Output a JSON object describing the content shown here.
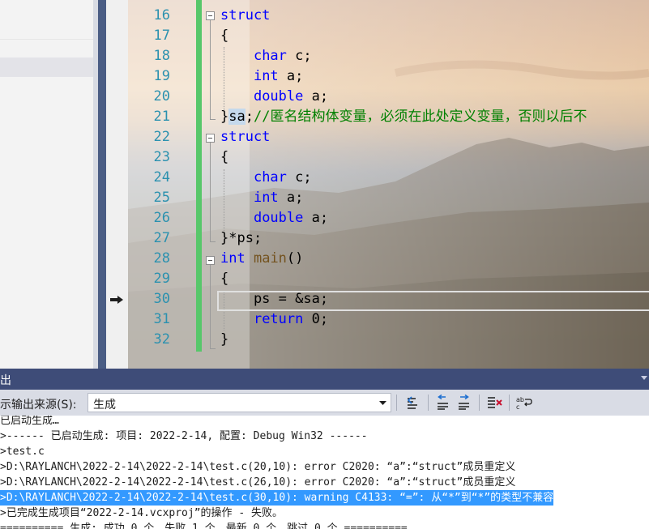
{
  "editor": {
    "line_numbers": [
      "16",
      "17",
      "18",
      "19",
      "20",
      "21",
      "22",
      "23",
      "24",
      "25",
      "26",
      "27",
      "28",
      "29",
      "30",
      "31",
      "32"
    ],
    "lines": [
      [
        {
          "t": "struct",
          "c": "kw"
        }
      ],
      [
        {
          "t": "{",
          "c": "id"
        }
      ],
      [
        {
          "t": "    ",
          "c": "id"
        },
        {
          "t": "char",
          "c": "kw"
        },
        {
          "t": " c;",
          "c": "id"
        }
      ],
      [
        {
          "t": "    ",
          "c": "id"
        },
        {
          "t": "int",
          "c": "kw"
        },
        {
          "t": " a;",
          "c": "id"
        }
      ],
      [
        {
          "t": "    ",
          "c": "id"
        },
        {
          "t": "double",
          "c": "kw"
        },
        {
          "t": " a;",
          "c": "id"
        }
      ],
      [
        {
          "t": "}",
          "c": "id"
        },
        {
          "t": "sa",
          "c": "id hl-sa"
        },
        {
          "t": ";",
          "c": "id"
        },
        {
          "t": "//匿名结构体变量，必须在此处定义变量，否则以后不",
          "c": "cm"
        }
      ],
      [
        {
          "t": "struct",
          "c": "kw"
        }
      ],
      [
        {
          "t": "{",
          "c": "id"
        }
      ],
      [
        {
          "t": "    ",
          "c": "id"
        },
        {
          "t": "char",
          "c": "kw"
        },
        {
          "t": " c;",
          "c": "id"
        }
      ],
      [
        {
          "t": "    ",
          "c": "id"
        },
        {
          "t": "int",
          "c": "kw"
        },
        {
          "t": " a;",
          "c": "id"
        }
      ],
      [
        {
          "t": "    ",
          "c": "id"
        },
        {
          "t": "double",
          "c": "kw"
        },
        {
          "t": " a;",
          "c": "id"
        }
      ],
      [
        {
          "t": "}*ps;",
          "c": "id"
        }
      ],
      [
        {
          "t": "int",
          "c": "kw"
        },
        {
          "t": " ",
          "c": "id"
        },
        {
          "t": "main",
          "c": "fn"
        },
        {
          "t": "()",
          "c": "id"
        }
      ],
      [
        {
          "t": "{",
          "c": "id"
        }
      ],
      [
        {
          "t": "    ps = &sa;",
          "c": "id"
        }
      ],
      [
        {
          "t": "    ",
          "c": "id"
        },
        {
          "t": "return",
          "c": "kw"
        },
        {
          "t": " 0;",
          "c": "id"
        }
      ],
      [
        {
          "t": "}",
          "c": "id"
        }
      ]
    ]
  },
  "output": {
    "title": "出",
    "source_label": "示输出来源(S):",
    "source_value": "生成",
    "lines": [
      "已启动生成…",
      ">------ 已启动生成: 项目: 2022-2-14, 配置: Debug Win32 ------",
      ">test.c",
      ">D:\\RAYLANCH\\2022-2-14\\2022-2-14\\test.c(20,10): error C2020: “a”:“struct”成员重定义",
      ">D:\\RAYLANCH\\2022-2-14\\2022-2-14\\test.c(26,10): error C2020: “a”:“struct”成员重定义",
      ">D:\\RAYLANCH\\2022-2-14\\2022-2-14\\test.c(30,10): warning C4133: “=”: 从“*”到“*”的类型不兼容",
      ">已完成生成项目“2022-2-14.vcxproj”的操作 - 失败。",
      "========== 生成: 成功 0 个，失败 1 个，最新 0 个，跳过 0 个 =========="
    ],
    "selected_line": 5
  },
  "icons": [
    "current-line-arrow-icon",
    "dropdown-arrow-icon",
    "find-in-output-icon",
    "previous-message-icon",
    "next-message-icon",
    "clear-all-icon",
    "word-wrap-icon"
  ]
}
